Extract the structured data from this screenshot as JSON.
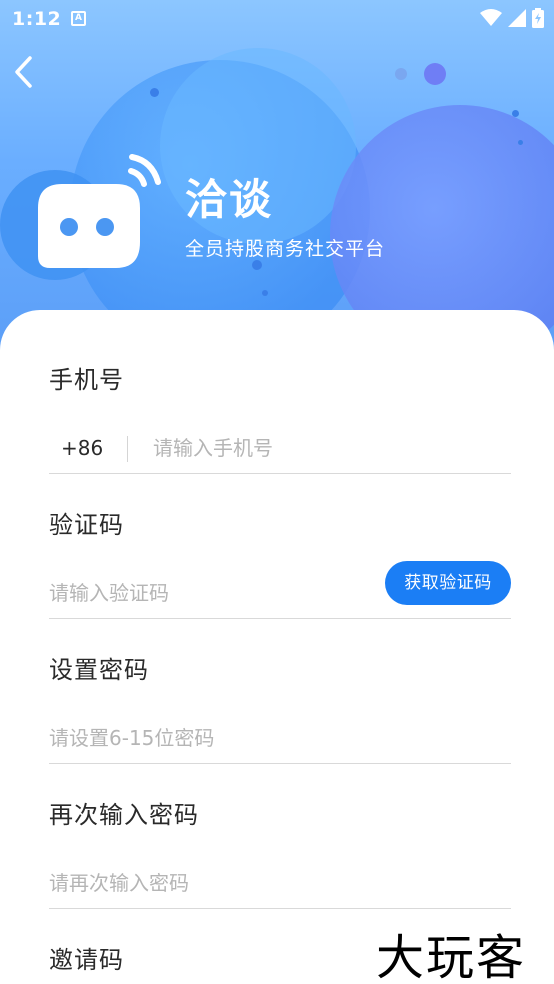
{
  "status": {
    "time": "1:12",
    "notif_letter": "A"
  },
  "header": {
    "title": "洽谈",
    "subtitle": "全员持股商务社交平台"
  },
  "form": {
    "phone": {
      "label": "手机号",
      "country_code": "+86",
      "placeholder": "请输入手机号"
    },
    "code": {
      "label": "验证码",
      "placeholder": "请输入验证码",
      "button_label": "获取验证码"
    },
    "password": {
      "label": "设置密码",
      "placeholder": "请设置6-15位密码"
    },
    "confirm": {
      "label": "再次输入密码",
      "placeholder": "请再次输入密码"
    },
    "invite": {
      "label": "邀请码"
    }
  },
  "watermark": "大玩客",
  "colors": {
    "accent": "#1b7ef5",
    "hero_top": "#8cc6ff",
    "hero_bottom": "#5b9ef7"
  },
  "icons": [
    "back-arrow-icon",
    "wifi-icon",
    "signal-icon",
    "battery-icon",
    "chat-bot-logo-icon"
  ]
}
